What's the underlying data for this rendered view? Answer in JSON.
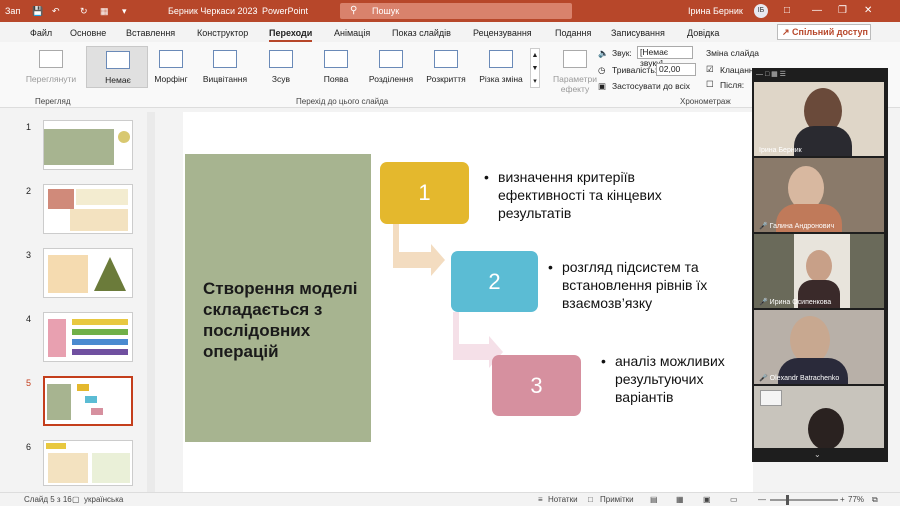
{
  "titlebar": {
    "autosave": "Зап",
    "doc_title": "Берник Черкаси 2023",
    "separator": "-",
    "app": "PowerPoint",
    "search_placeholder": "Пошук",
    "user": "Ірина Берник",
    "user_initials": "ІБ"
  },
  "menu": {
    "items": [
      "Файл",
      "Основне",
      "Вставлення",
      "Конструктор",
      "Переходи",
      "Анімація",
      "Показ слайдів",
      "Рецензування",
      "Подання",
      "Записування",
      "Довідка"
    ],
    "active": "Переходи",
    "share": "Спільний доступ"
  },
  "ribbon": {
    "preview": "Переглянути",
    "preview_group": "Перегляд",
    "transitions": [
      "Немає",
      "Морфінг",
      "Вицвітання",
      "Зсув",
      "Поява",
      "Розділення",
      "Розкриття",
      "Різка зміна"
    ],
    "transitions_group": "Перехід до цього слайда",
    "effect_params": "Параметри ефекту",
    "sound_label": "Звук:",
    "sound_value": "[Немає звуку]",
    "duration_label": "Тривалість:",
    "duration_value": "02,00",
    "apply_all": "Застосувати до всіх",
    "advance_header": "Зміна слайда",
    "on_click": "Клацання",
    "after": "Після:",
    "timing_group": "Хронометраж"
  },
  "thumbs": {
    "numbers": [
      "1",
      "2",
      "3",
      "4",
      "5",
      "6"
    ],
    "selected": "5"
  },
  "slide": {
    "title": "Створення моделі складається з послідовних операцій",
    "steps": [
      {
        "n": "1",
        "text": "визначення критеріїв ефективності та кінцевих результатів"
      },
      {
        "n": "2",
        "text": "розгляд підсистем та встановлення рівнів їх взаємозв’язку"
      },
      {
        "n": "3",
        "text": "аналіз можливих результуючих варіантів"
      }
    ],
    "colors": {
      "panel": "#a7b490",
      "step1": "#e4b82d",
      "step2": "#5bbcd4",
      "step3": "#d6909f"
    }
  },
  "participants": [
    {
      "name": "Ірина Берник",
      "muted": false
    },
    {
      "name": "Галина Андронович",
      "muted": true
    },
    {
      "name": "Ирина Осипенкова",
      "muted": true
    },
    {
      "name": "Olexandr Batrachenko",
      "muted": true
    },
    {
      "name": "",
      "muted": false
    }
  ],
  "status": {
    "slide_info": "Слайд 5 з 16",
    "language": "українська",
    "notes": "Нотатки",
    "comments": "Примітки",
    "zoom": "77%"
  }
}
